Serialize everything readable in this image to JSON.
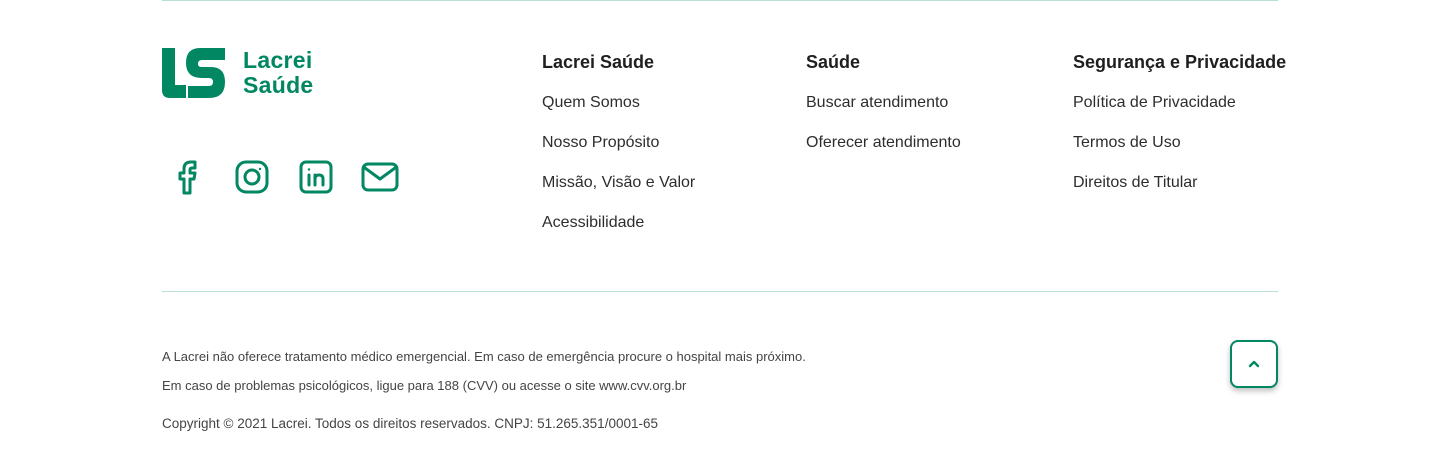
{
  "brand": {
    "name_line1": "Lacrei",
    "name_line2": "Saúde",
    "color": "#018762"
  },
  "social": [
    {
      "icon": "facebook-icon"
    },
    {
      "icon": "instagram-icon"
    },
    {
      "icon": "linkedin-icon"
    },
    {
      "icon": "email-icon"
    }
  ],
  "columns": [
    {
      "title": "Lacrei Saúde",
      "links": [
        "Quem Somos",
        "Nosso Propósito",
        "Missão, Visão e Valor",
        "Acessibilidade"
      ]
    },
    {
      "title": "Saúde",
      "links": [
        "Buscar atendimento",
        "Oferecer atendimento"
      ]
    },
    {
      "title": "Segurança e Privacidade",
      "links": [
        "Política de Privacidade",
        "Termos de Uso",
        "Direitos de Titular"
      ]
    }
  ],
  "disclaimer": {
    "line1": "A Lacrei não oferece tratamento médico emergencial. Em caso de emergência procure o hospital mais próximo.",
    "line2": "Em caso de problemas psicológicos, ligue para 188 (CVV) ou acesse o site www.cvv.org.br"
  },
  "copyright": "Copyright © 2021 Lacrei. Todos os direitos reservados. CNPJ: 51.265.351/0001-65",
  "back_to_top": {
    "icon": "chevron-up-icon"
  }
}
